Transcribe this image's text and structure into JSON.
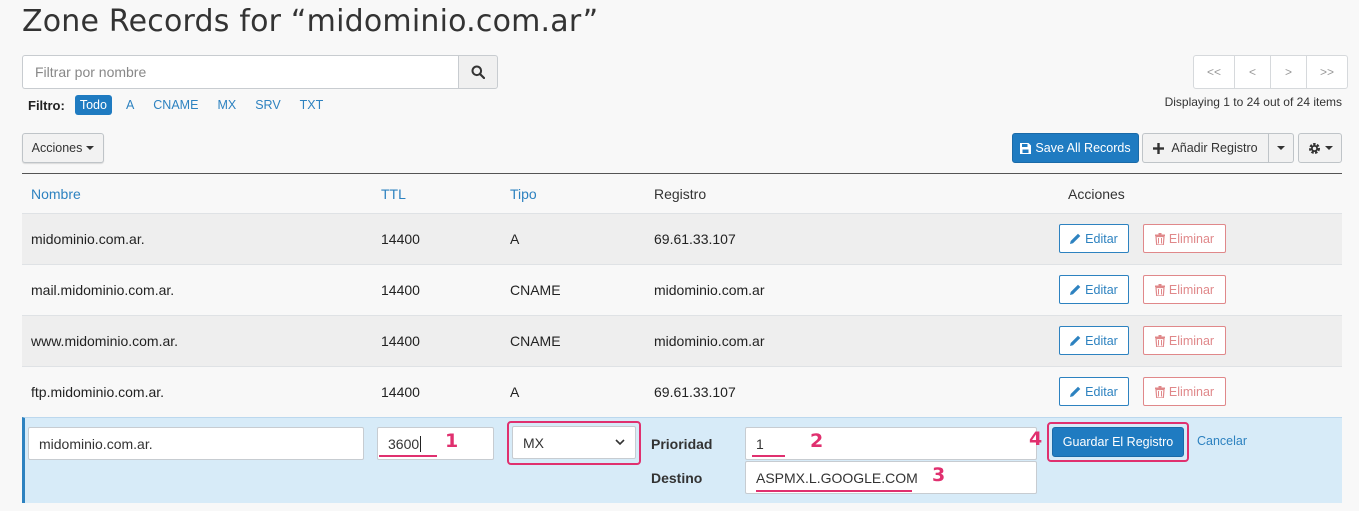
{
  "page": {
    "title": "Zone Records for “midominio.com.ar”"
  },
  "search": {
    "placeholder": "Filtrar por nombre",
    "icon": "search-icon"
  },
  "filter": {
    "label": "Filtro:",
    "options": [
      "Todo",
      "A",
      "CNAME",
      "MX",
      "SRV",
      "TXT"
    ],
    "active": "Todo"
  },
  "pager": {
    "first": "<<",
    "prev": "<",
    "next": ">",
    "last": ">>",
    "status": "Displaying 1 to 24 out of 24 items"
  },
  "toolbar": {
    "acciones_label": "Acciones",
    "save_all_label": "Save All Records",
    "add_label": "Añadir Registro"
  },
  "table": {
    "headers": {
      "nombre": "Nombre",
      "ttl": "TTL",
      "tipo": "Tipo",
      "registro": "Registro",
      "acciones": "Acciones"
    },
    "rows": [
      {
        "nombre": "midominio.com.ar.",
        "ttl": "14400",
        "tipo": "A",
        "registro": "69.61.33.107"
      },
      {
        "nombre": "mail.midominio.com.ar.",
        "ttl": "14400",
        "tipo": "CNAME",
        "registro": "midominio.com.ar"
      },
      {
        "nombre": "www.midominio.com.ar.",
        "ttl": "14400",
        "tipo": "CNAME",
        "registro": "midominio.com.ar"
      },
      {
        "nombre": "ftp.midominio.com.ar.",
        "ttl": "14400",
        "tipo": "A",
        "registro": "69.61.33.107"
      }
    ],
    "edit_label": "Editar",
    "delete_label": "Eliminar"
  },
  "edit_row": {
    "nombre_value": "midominio.com.ar.",
    "ttl_value": "3600",
    "tipo_value": "MX",
    "prioridad_label": "Prioridad",
    "prioridad_value": "1",
    "destino_label": "Destino",
    "destino_value": "ASPMX.L.GOOGLE.COM",
    "save_label": "Guardar El Registro",
    "cancel_label": "Cancelar"
  },
  "annotations": [
    "1",
    "2",
    "3",
    "4"
  ],
  "colors": {
    "accent": "#1f7bc1",
    "link": "#2d82c0",
    "danger": "#e0888a",
    "highlight": "#e0306f",
    "edit_row_bg": "#d7ebf8"
  }
}
